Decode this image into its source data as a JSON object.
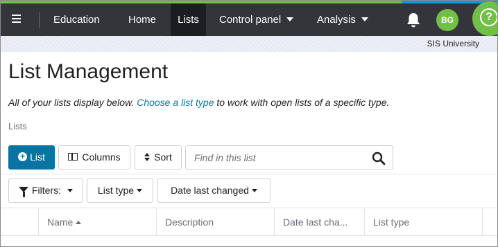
{
  "colors": {
    "nav_bg": "#34353b",
    "nav_active_bg": "#1c1d21",
    "accent_green": "#71bf44",
    "accent_blue": "#0974a1",
    "stripe_blue": "#0a9bd8"
  },
  "nav": {
    "menu_icon": "hamburger-icon",
    "items": [
      {
        "label": "Education"
      },
      {
        "label": "Home"
      },
      {
        "label": "Lists",
        "active": true
      },
      {
        "label": "Control panel",
        "dropdown": true
      },
      {
        "label": "Analysis",
        "dropdown": true
      }
    ],
    "notifications_icon": "bell-icon",
    "avatar_initials": "BG",
    "help_label": "?"
  },
  "org_name": "SIS University",
  "page": {
    "title": "List Management",
    "intro_before": "All of your lists display below. ",
    "intro_link": "Choose a list type",
    "intro_after": " to work with open lists of a specific type.",
    "breadcrumb": "Lists"
  },
  "toolbar": {
    "add_label": "List",
    "columns_label": "Columns",
    "sort_label": "Sort",
    "search_placeholder": "Find in this list"
  },
  "filters": {
    "filters_label": "Filters:",
    "list_type_label": "List type",
    "date_changed_label": "Date last changed"
  },
  "grid": {
    "columns": [
      {
        "label": "Name",
        "sorted": "asc"
      },
      {
        "label": "Description"
      },
      {
        "label": "Date last cha..."
      },
      {
        "label": "List type"
      }
    ]
  }
}
